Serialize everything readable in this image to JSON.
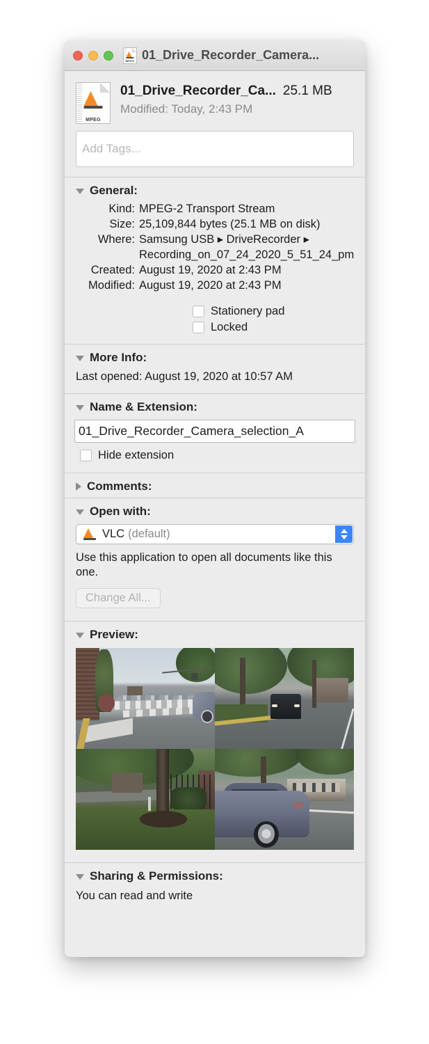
{
  "window": {
    "title": "01_Drive_Recorder_Camera...",
    "traffic_lights": [
      "close",
      "minimize",
      "zoom"
    ]
  },
  "header": {
    "file_name_truncated": "01_Drive_Recorder_Ca...",
    "file_size": "25.1 MB",
    "modified_label": "Modified:",
    "modified_value": "Today, 2:43 PM",
    "icon_badge": "MPEG"
  },
  "tags": {
    "placeholder": "Add Tags...",
    "value": ""
  },
  "general": {
    "title": "General:",
    "rows": [
      {
        "label": "Kind:",
        "value": "MPEG-2 Transport Stream"
      },
      {
        "label": "Size:",
        "value": "25,109,844 bytes (25.1 MB on disk)"
      },
      {
        "label": "Where:",
        "value": "Samsung USB ▸ DriveRecorder ▸ Recording_on_07_24_2020_5_51_24_pm"
      },
      {
        "label": "Created:",
        "value": "August 19, 2020 at 2:43 PM"
      },
      {
        "label": "Modified:",
        "value": "August 19, 2020 at 2:43 PM"
      }
    ],
    "checkboxes": [
      {
        "label": "Stationery pad",
        "checked": false
      },
      {
        "label": "Locked",
        "checked": false
      }
    ]
  },
  "more_info": {
    "title": "More Info:",
    "last_opened_label": "Last opened:",
    "last_opened_value": "August 19, 2020 at 10:57 AM"
  },
  "name_extension": {
    "title": "Name & Extension:",
    "value": "01_Drive_Recorder_Camera_selection_A",
    "hide_extension_label": "Hide extension",
    "hide_extension_checked": false
  },
  "comments": {
    "title": "Comments:",
    "expanded": false
  },
  "open_with": {
    "title": "Open with:",
    "app_name": "VLC",
    "app_default_suffix": "(default)",
    "description": "Use this application to open all documents like this one.",
    "change_all_label": "Change All...",
    "change_all_enabled": false
  },
  "preview": {
    "title": "Preview:",
    "quadrants": [
      "front-camera-intersection-crosswalk",
      "front-camera-tree-lined-street-suv",
      "side-camera-yard-iron-fence",
      "side-camera-parked-sedan"
    ]
  },
  "sharing": {
    "title": "Sharing & Permissions:",
    "permission_text": "You can read and write"
  },
  "colors": {
    "window_bg": "#ececec",
    "titlebar": "#e2e2e2",
    "accent_blue": "#3b86f7",
    "close_red": "#f2655a",
    "min_yellow": "#f5bd4f",
    "zoom_green": "#61c554",
    "text": "#1c1c1c",
    "muted_text": "#8b8b8b"
  }
}
